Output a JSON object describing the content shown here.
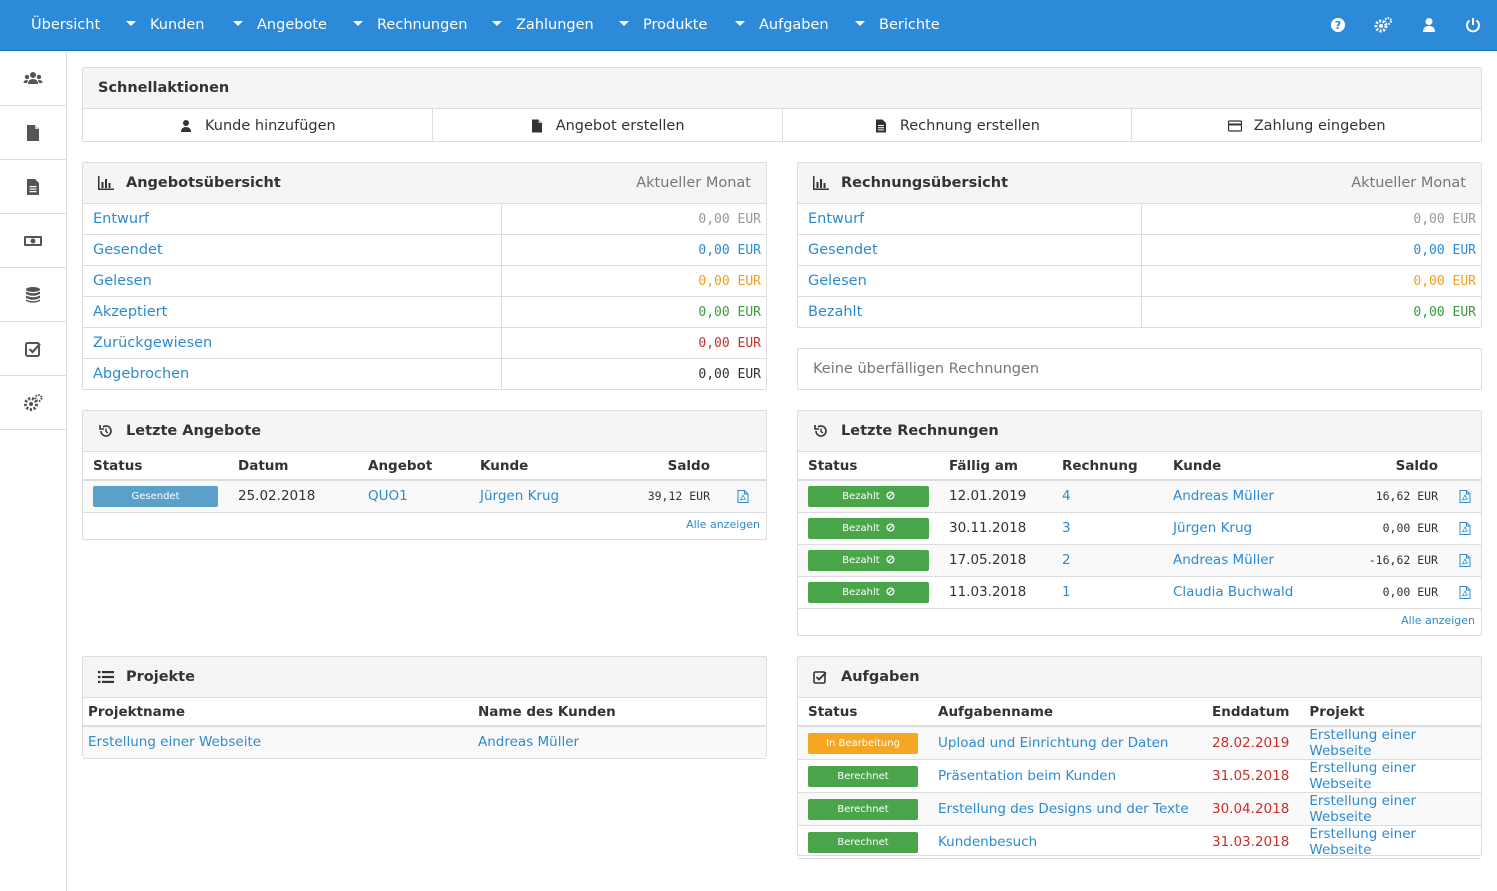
{
  "nav": {
    "items": [
      "Übersicht",
      "Kunden",
      "Angebote",
      "Rechnungen",
      "Zahlungen",
      "Produkte",
      "Aufgaben",
      "Berichte"
    ],
    "icons": [
      "help-icon",
      "settings-icon",
      "user-icon",
      "power-icon"
    ]
  },
  "sidebar": {
    "icons": [
      "clients-icon",
      "quotes-icon",
      "invoices-icon",
      "payments-icon",
      "products-icon",
      "tasks-icon",
      "settings-icon"
    ]
  },
  "quick_actions": {
    "title": "Schnellaktionen",
    "buttons": [
      "Kunde hinzufügen",
      "Angebot erstellen",
      "Rechnung erstellen",
      "Zahlung eingeben"
    ]
  },
  "quote_overview": {
    "title": "Angebotsübersicht",
    "period": "Aktueller Monat",
    "rows": [
      {
        "label": "Entwurf",
        "value": "0,00 EUR",
        "color": "#999999"
      },
      {
        "label": "Gesendet",
        "value": "0,00 EUR",
        "color": "#2c8bd0"
      },
      {
        "label": "Gelesen",
        "value": "0,00 EUR",
        "color": "#f0a020"
      },
      {
        "label": "Akzeptiert",
        "value": "0,00 EUR",
        "color": "#3c9a3c"
      },
      {
        "label": "Zurückgewiesen",
        "value": "0,00 EUR",
        "color": "#c9302c"
      },
      {
        "label": "Abgebrochen",
        "value": "0,00 EUR",
        "color": "#333333"
      }
    ]
  },
  "invoice_overview": {
    "title": "Rechnungsübersicht",
    "period": "Aktueller Monat",
    "rows": [
      {
        "label": "Entwurf",
        "value": "0,00 EUR",
        "color": "#999999"
      },
      {
        "label": "Gesendet",
        "value": "0,00 EUR",
        "color": "#2c8bd0"
      },
      {
        "label": "Gelesen",
        "value": "0,00 EUR",
        "color": "#f0a020"
      },
      {
        "label": "Bezahlt",
        "value": "0,00 EUR",
        "color": "#3c9a3c"
      }
    ],
    "overdue_text": "Keine überfälligen Rechnungen"
  },
  "recent_quotes": {
    "title": "Letzte Angebote",
    "headers": [
      "Status",
      "Datum",
      "Angebot",
      "Kunde",
      "Saldo"
    ],
    "rows": [
      {
        "status": "Gesendet",
        "date": "25.02.2018",
        "quote": "QUO1",
        "client": "Jürgen Krug",
        "balance": "39,12 EUR"
      }
    ],
    "all_link": "Alle anzeigen"
  },
  "recent_invoices": {
    "title": "Letzte Rechnungen",
    "headers": [
      "Status",
      "Fällig am",
      "Rechnung",
      "Kunde",
      "Saldo"
    ],
    "rows": [
      {
        "status": "Bezahlt",
        "due": "12.01.2019",
        "invoice": "4",
        "client": "Andreas Müller",
        "balance": "16,62 EUR"
      },
      {
        "status": "Bezahlt",
        "due": "30.11.2018",
        "invoice": "3",
        "client": "Jürgen Krug",
        "balance": "0,00 EUR"
      },
      {
        "status": "Bezahlt",
        "due": "17.05.2018",
        "invoice": "2",
        "client": "Andreas Müller",
        "balance": "-16,62 EUR"
      },
      {
        "status": "Bezahlt",
        "due": "11.03.2018",
        "invoice": "1",
        "client": "Claudia Buchwald",
        "balance": "0,00 EUR"
      }
    ],
    "all_link": "Alle anzeigen"
  },
  "projects": {
    "title": "Projekte",
    "headers": [
      "Projektname",
      "Name des Kunden"
    ],
    "rows": [
      {
        "name": "Erstellung einer Webseite",
        "client": "Andreas Müller"
      }
    ]
  },
  "tasks": {
    "title": "Aufgaben",
    "headers": [
      "Status",
      "Aufgabenname",
      "Enddatum",
      "Projekt"
    ],
    "rows": [
      {
        "status": "In Bearbeitung",
        "status_color": "#f5a623",
        "name": "Upload und Einrichtung der Daten",
        "end": "28.02.2019",
        "project": "Erstellung einer Webseite"
      },
      {
        "status": "Berechnet",
        "status_color": "#4aa44a",
        "name": "Präsentation beim Kunden",
        "end": "31.05.2018",
        "project": "Erstellung einer Webseite"
      },
      {
        "status": "Berechnet",
        "status_color": "#4aa44a",
        "name": "Erstellung des Designs und der Texte",
        "end": "30.04.2018",
        "project": "Erstellung einer Webseite"
      },
      {
        "status": "Berechnet",
        "status_color": "#4aa44a",
        "name": "Kundenbesuch",
        "end": "31.03.2018",
        "project": "Erstellung einer Webseite"
      }
    ]
  }
}
